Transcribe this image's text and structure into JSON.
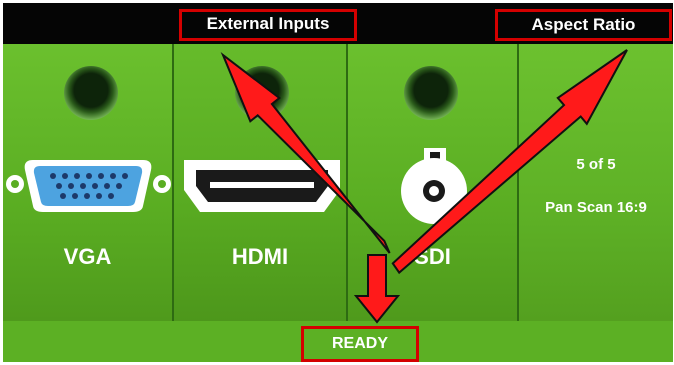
{
  "header": {
    "external_inputs_label": "External Inputs",
    "aspect_ratio_label": "Aspect Ratio"
  },
  "inputs": [
    {
      "label": "VGA",
      "icon": "vga-connector-icon"
    },
    {
      "label": "HDMI",
      "icon": "hdmi-connector-icon"
    },
    {
      "label": "SDI",
      "icon": "sdi-connector-icon"
    }
  ],
  "aspect": {
    "position": "5 of 5",
    "mode": "Pan Scan 16:9"
  },
  "footer": {
    "status": "READY"
  },
  "colors": {
    "panel_green": "#5cb024",
    "highlight_red": "#d40000",
    "arrow_red": "#ff1a1a",
    "top_bar": "#050505"
  }
}
